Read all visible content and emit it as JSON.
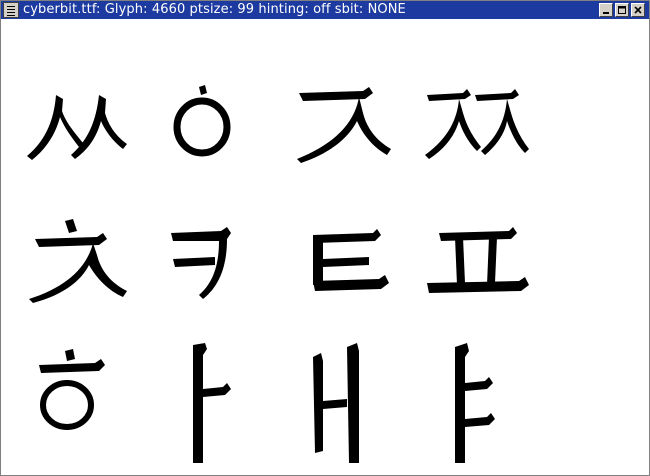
{
  "window": {
    "title": "cyberbit.ttf:    Glyph: 4660  ptsize:   99  hinting: off  sbit: NONE",
    "sysmenu_icon": "window-menu-icon",
    "minimize_icon": "minimize-icon",
    "maximize_icon": "maximize-icon",
    "close_icon": "close-icon",
    "titlebar_color": "#1c3aa0"
  },
  "glyphs": [
    {
      "char": "ㅆ"
    },
    {
      "char": "ㅇ"
    },
    {
      "char": "ㅈ"
    },
    {
      "char": "ㅉ"
    },
    {
      "char": "ㅊ"
    },
    {
      "char": "ㅋ"
    },
    {
      "char": "ㅌ"
    },
    {
      "char": "ㅍ"
    },
    {
      "char": "ㅎ"
    },
    {
      "char": "ㅏ"
    },
    {
      "char": "ㅐ"
    },
    {
      "char": "ㅑ"
    }
  ]
}
